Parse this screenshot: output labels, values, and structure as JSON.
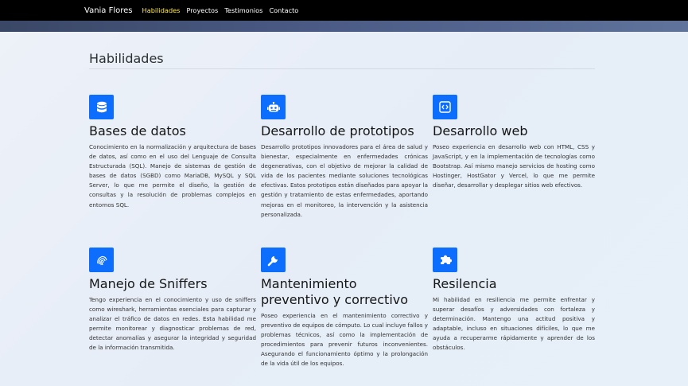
{
  "navbar": {
    "brand": "Vania Flores",
    "links": [
      {
        "label": "Habilidades",
        "active": true
      },
      {
        "label": "Proyectos",
        "active": false
      },
      {
        "label": "Testimonios",
        "active": false
      },
      {
        "label": "Contacto",
        "active": false
      }
    ]
  },
  "section": {
    "title": "Habilidades",
    "cards": [
      {
        "icon": "database-icon",
        "title": "Bases de datos",
        "text": "Conocimiento en la normalización y arquitectura de bases de datos, así como en el uso del Lenguaje de Consulta Estructurada (SQL). Manejo de sistemas de gestión de bases de datos (SGBD) como MariaDB, MySQL y SQL Server, lo que me permite el diseño, la gestión de consultas y la resolución de problemas complejos en entornos SQL."
      },
      {
        "icon": "robot-icon",
        "title": "Desarrollo de prototipos",
        "text": "Desarrollo prototipos innovadores para el área de salud y bienestar, especialmente en enfermedades crónicas degenerativas, con el objetivo de mejorar la calidad de vida de los pacientes mediante soluciones tecnológicas efectivas. Estos prototipos están diseñados para apoyar la gestión y tratamiento de estas enfermedades, aportando mejoras en el monitoreo, la intervención y la asistencia personalizada."
      },
      {
        "icon": "code-icon",
        "title": "Desarrollo web",
        "text": "Poseo experiencia en desarrollo web con HTML, CSS y JavaScript, y en la implementación de tecnologías como Bootstrap. Así mismo manejo servicios de hosting como Hostinger, HostGator y Vercel, lo que me permite diseñar, desarrollar y desplegar sitios web efectivos."
      },
      {
        "icon": "fingerprint-icon",
        "title": "Manejo de Sniffers",
        "text": "Tengo experiencia en el conocimiento y uso de sniffers como wireshark, herramientas esenciales para capturar y analizar el tráfico de datos en redes. Esta habilidad me permite monitorear y diagnosticar problemas de red, detectar anomalías y asegurar la integridad y seguridad de la información transmitida."
      },
      {
        "icon": "wrench-icon",
        "title": "Mantenimiento preventivo y correctivo",
        "text": "Poseo experiencia en el mantenimiento correctivo y preventivo de equipos de cómputo. Lo cual incluye fallos y problemas técnicos, así como la implementación de procedimientos para prevenir futuros inconvenientes. Asegurando el funcionamiento óptimo y la prolongación de la vida útil de los equipos."
      },
      {
        "icon": "puzzle-icon",
        "title": "Resilencia",
        "text": "Mi habilidad en resiliencia me permite enfrentar y superar desafíos y adversidades con fortaleza y determinación. Mantengo una actitud positiva y adaptable, incluso en situaciones difíciles, lo que me ayuda a recuperarme rápidamente y aprender de los obstáculos."
      }
    ]
  },
  "colors": {
    "navbar_bg": "#000000",
    "active_link": "#ffe94f",
    "icon_bg": "#0d6efd"
  }
}
